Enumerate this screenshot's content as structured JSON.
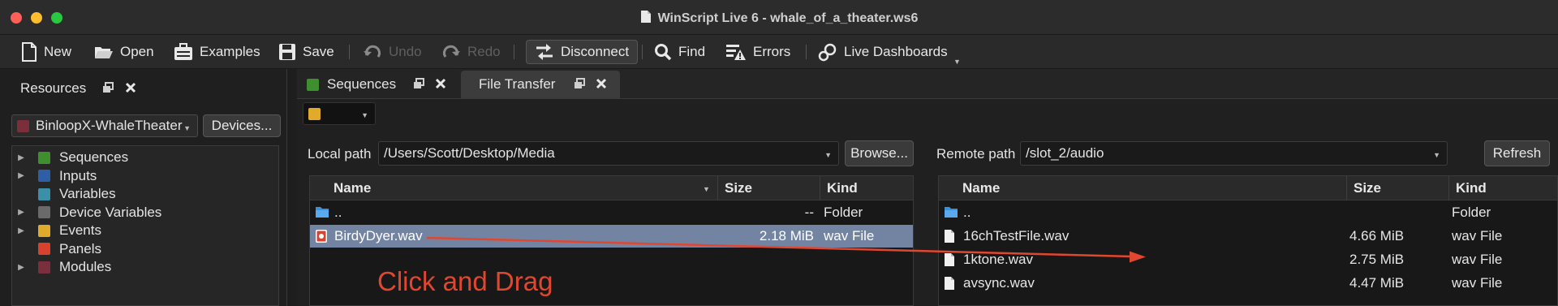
{
  "window": {
    "title": "WinScript Live 6 - whale_of_a_theater.ws6"
  },
  "toolbar": {
    "new": "New",
    "open": "Open",
    "examples": "Examples",
    "save": "Save",
    "undo": "Undo",
    "redo": "Redo",
    "disconnect": "Disconnect",
    "find": "Find",
    "errors": "Errors",
    "live_dashboards": "Live Dashboards"
  },
  "resources": {
    "title": "Resources",
    "device": "BinloopX-WhaleTheater",
    "device_color": "#7b2f3c",
    "devices_button": "Devices...",
    "items": [
      {
        "label": "Sequences",
        "color": "#3f8f2f",
        "expandable": true
      },
      {
        "label": "Inputs",
        "color": "#2f5ea8",
        "expandable": true
      },
      {
        "label": "Variables",
        "color": "#3b8fa8",
        "expandable": false
      },
      {
        "label": "Device Variables",
        "color": "#6a6a6a",
        "expandable": true
      },
      {
        "label": "Events",
        "color": "#e0aa2a",
        "expandable": true
      },
      {
        "label": "Panels",
        "color": "#d9412f",
        "expandable": false
      },
      {
        "label": "Modules",
        "color": "#7b2f3c",
        "expandable": true
      }
    ]
  },
  "tabs": {
    "sequences": "Sequences",
    "sequences_color": "#3f8f2f",
    "file_transfer": "File Transfer"
  },
  "color_selector": {
    "color": "#e0aa2a"
  },
  "local": {
    "label": "Local path",
    "path": "/Users/Scott/Desktop/Media",
    "browse_button": "Browse...",
    "columns": [
      "Name",
      "Size",
      "Kind"
    ],
    "rows": [
      {
        "name": "..",
        "size": "--",
        "kind": "Folder",
        "type": "folder"
      },
      {
        "name": "BirdyDyer.wav",
        "size": "2.18 MiB",
        "kind": "wav File",
        "type": "audio",
        "selected": true
      }
    ]
  },
  "remote": {
    "label": "Remote path",
    "path": "/slot_2/audio",
    "refresh_button": "Refresh",
    "columns": [
      "Name",
      "Size",
      "Kind"
    ],
    "rows": [
      {
        "name": "..",
        "size": "",
        "kind": "Folder",
        "type": "folder"
      },
      {
        "name": "16chTestFile.wav",
        "size": "4.66 MiB",
        "kind": "wav File",
        "type": "file"
      },
      {
        "name": "1ktone.wav",
        "size": "2.75 MiB",
        "kind": "wav File",
        "type": "file"
      },
      {
        "name": "avsync.wav",
        "size": "4.47 MiB",
        "kind": "wav File",
        "type": "file"
      }
    ]
  },
  "annotation": {
    "text": "Click and Drag",
    "color": "#e0472f"
  }
}
